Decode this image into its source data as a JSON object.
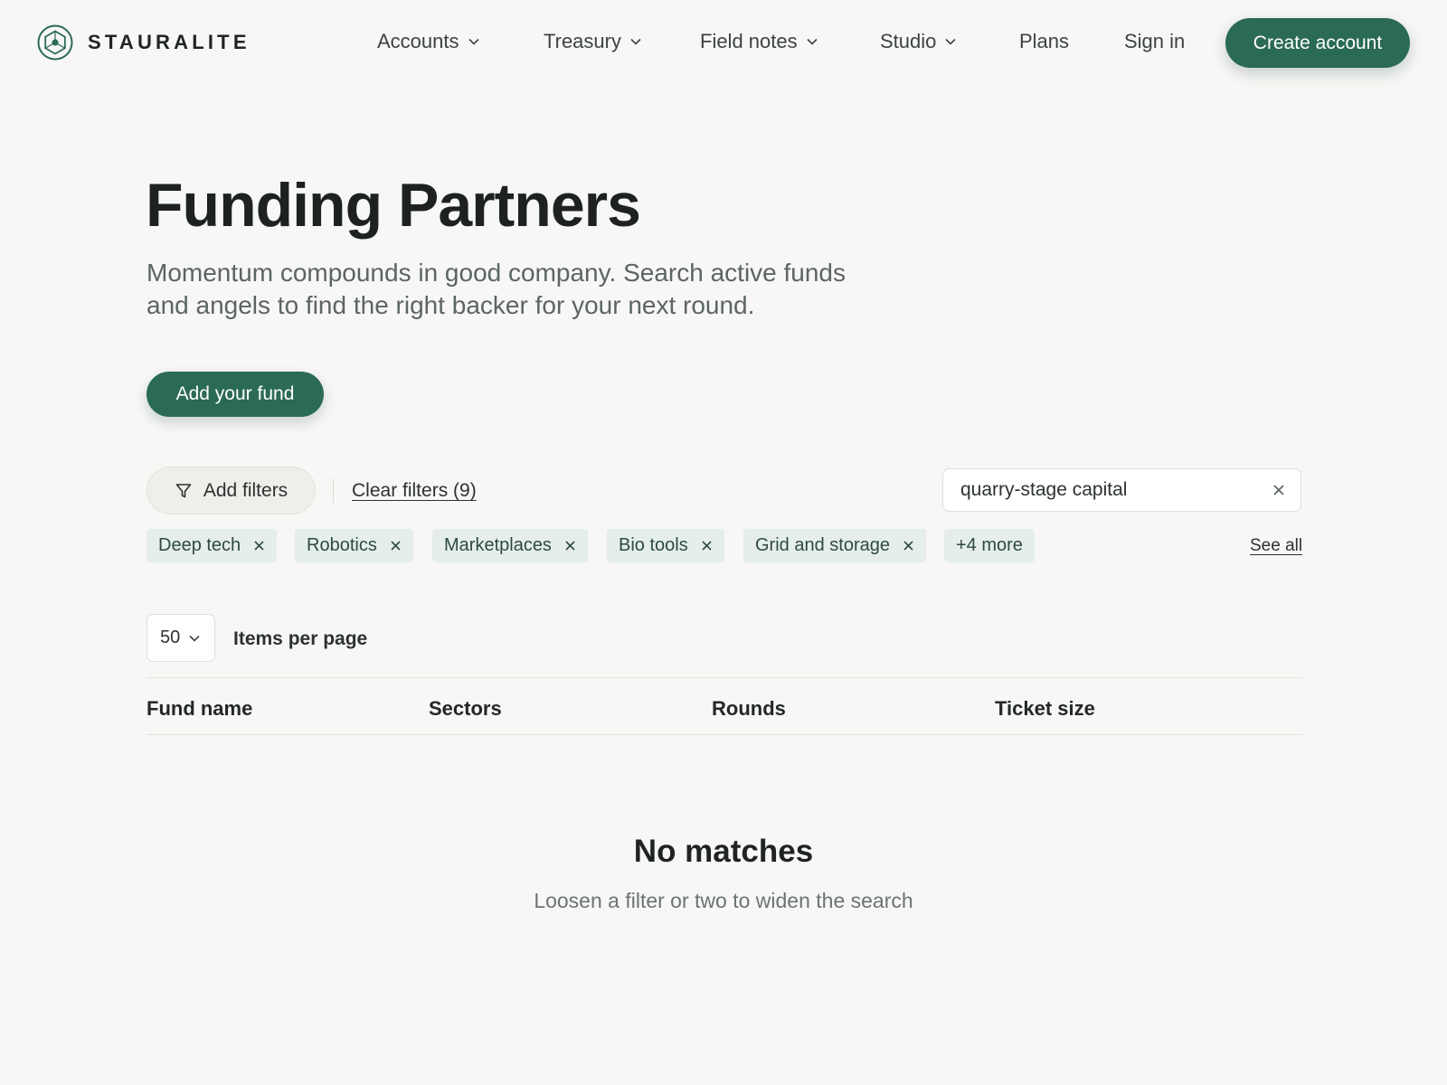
{
  "brand": {
    "name": "STAURALITE",
    "logo_icon": "hexagon-cube-icon",
    "accent": "#2b6a55"
  },
  "nav": {
    "items": [
      {
        "label": "Accounts",
        "has_dropdown": true
      },
      {
        "label": "Treasury",
        "has_dropdown": true
      },
      {
        "label": "Field notes",
        "has_dropdown": true
      },
      {
        "label": "Studio",
        "has_dropdown": true
      },
      {
        "label": "Plans",
        "has_dropdown": false
      },
      {
        "label": "Sign in",
        "has_dropdown": false
      }
    ],
    "cta_label": "Create account"
  },
  "hero": {
    "title": "Funding Partners",
    "subtitle": "Momentum compounds in good company. Search active funds and angels to find the right backer for your next round.",
    "primary_button": "Add your fund"
  },
  "filters": {
    "add_label": "Add filters",
    "clear_label": "Clear filters (9)",
    "search_value": "quarry-stage capital",
    "chips": [
      "Deep tech",
      "Robotics",
      "Marketplaces",
      "Bio tools",
      "Grid and storage"
    ],
    "more_label": "+4 more",
    "see_all_label": "See all"
  },
  "table": {
    "per_page_value": "50",
    "per_page_label": "Items per page",
    "columns": [
      "Fund name",
      "Sectors",
      "Rounds",
      "Ticket size"
    ],
    "rows": []
  },
  "empty_state": {
    "title": "No matches",
    "subtitle": "Loosen a filter or two to widen the search"
  }
}
